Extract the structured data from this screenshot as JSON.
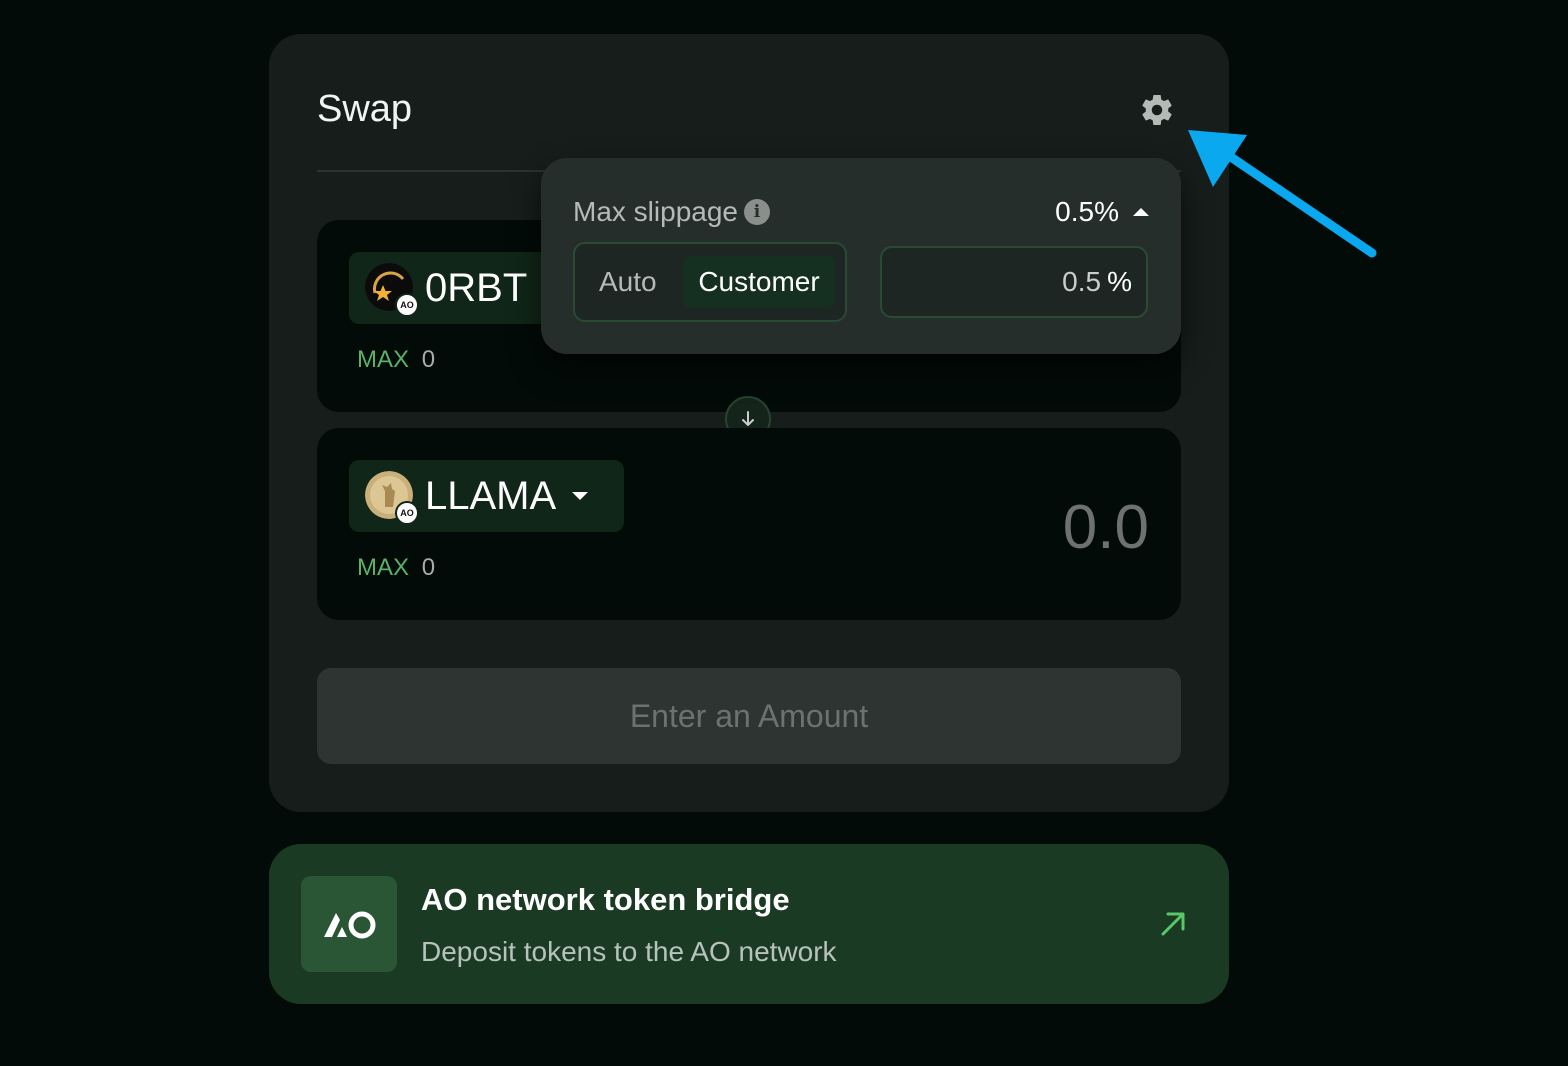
{
  "swap": {
    "title": "Swap",
    "settings_icon": "gear-icon",
    "from": {
      "token": "0RBT",
      "max_label": "MAX",
      "max_value": "0"
    },
    "to": {
      "token": "LLAMA",
      "max_label": "MAX",
      "max_value": "0",
      "amount": "0.0"
    },
    "submit_label": "Enter an Amount"
  },
  "slippage": {
    "label": "Max slippage",
    "current": "0.5%",
    "modes": [
      "Auto",
      "Customer"
    ],
    "selected_mode": "Customer",
    "input_value": "0.5",
    "unit": "%"
  },
  "bridge": {
    "title": "AO network token bridge",
    "subtitle": "Deposit tokens to the AO network"
  },
  "colors": {
    "background": "#020b08",
    "card": "#161d1a",
    "accent_green": "#58b368",
    "bridge_bg": "#1a3a23",
    "annotation_arrow": "#0aa8ee"
  }
}
